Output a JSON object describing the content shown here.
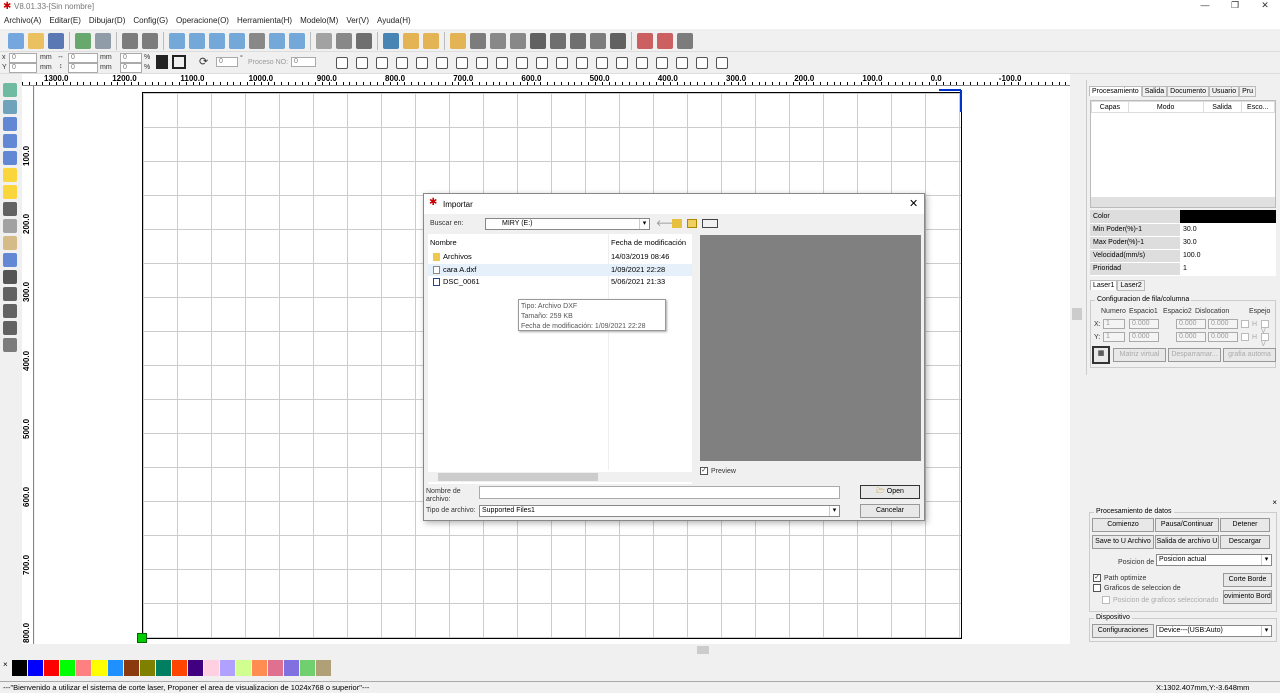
{
  "app": {
    "title": "V8.01.33-[Sin nombre]"
  },
  "window_controls": [
    "—",
    "❐",
    "✕"
  ],
  "menu": [
    "Archivo(A)",
    "Editar(E)",
    "Dibujar(D)",
    "Config(G)",
    "Operacione(O)",
    "Herramienta(H)",
    "Modelo(M)",
    "Ver(V)",
    "Ayuda(H)"
  ],
  "toolbar1_icons": [
    "new-file",
    "open-folder",
    "save",
    "import",
    "export",
    "back",
    "forward",
    "zoom-out-page",
    "zoom-in",
    "zoom-out",
    "zoom-fit",
    "zoom-actual",
    "zoom-select",
    "zoom-search",
    "rectangle-select",
    "node-edit",
    "smooth",
    "monitor",
    "layer-a",
    "layer-b",
    "layer-c",
    "curve",
    "bmp",
    "frame",
    "tree",
    "align-h",
    "measure",
    "camera",
    "book",
    "laser-pen",
    "red-dot-laser",
    "array"
  ],
  "toolbar2": {
    "x_label": "x",
    "y_label": "Y",
    "x_value": "0",
    "y_value": "0",
    "unit": "mm",
    "w_value": "0",
    "h_value": "0",
    "pct": "%",
    "sx_value": "0",
    "sy_value": "0",
    "rotate_value": "0",
    "degree": "°",
    "process_label": "Proceso NO:",
    "process_value": "0"
  },
  "ruler_top": [
    "1300.0",
    "1200.0",
    "1100.0",
    "1000.0",
    "900.0",
    "800.0",
    "700.0",
    "600.0",
    "500.0",
    "400.0",
    "300.0",
    "200.0",
    "100.0",
    "0.0",
    "-100.0"
  ],
  "ruler_left": [
    "100.0",
    "200.0",
    "300.0",
    "400.0",
    "500.0",
    "600.0",
    "700.0",
    "800.0"
  ],
  "right_panel": {
    "tabs": [
      "Procesamiento",
      "Salida",
      "Documento",
      "Usuario",
      "Pru"
    ],
    "layer_columns": [
      "Capas",
      "Modo",
      "Salida",
      "Esco..."
    ],
    "props": [
      {
        "label": "Color",
        "value": ""
      },
      {
        "label": "Min Poder(%)-1",
        "value": "30.0"
      },
      {
        "label": "Max Poder(%)-1",
        "value": "30.0"
      },
      {
        "label": "Velocidad(mm/s)",
        "value": "100.0"
      },
      {
        "label": "Prioridad",
        "value": "1"
      }
    ],
    "color_value": "#000000",
    "laser_tabs": [
      "Laser1",
      "Laser2"
    ],
    "array": {
      "title": "Configuracion de fila/columna",
      "cols": [
        "Numero",
        "Espacio1",
        "Espacio2",
        "Dislocation",
        "Espejo"
      ],
      "x_label": "X:",
      "y_label": "Y:",
      "x": [
        "1",
        "0.000",
        "0.000",
        "0.000"
      ],
      "y": [
        "1",
        "0.000",
        "0.000",
        "0.000"
      ],
      "h": "H",
      "v": "V",
      "buttons": [
        "Matriz virtual",
        "Desparramar...",
        "grafia automa"
      ]
    }
  },
  "data_panel": {
    "title": "Procesamiento de datos",
    "buttons": [
      "Comienzo",
      "Pausa/Continuar",
      "Detener",
      "Save to U Archivo",
      "Salida de archivo U",
      "Descargar"
    ],
    "pos_label": "Posicion de",
    "pos_value": "Posicion actual",
    "path_optimize": "Path optimize",
    "graficos_sel": "Graficos de seleccion de",
    "posicion_sel": "Posicion de graficos seleccionado",
    "corte_borde": "Corte Borde",
    "movimiento_borde": "ovimiento Bord",
    "device_title": "Dispositivo",
    "config_button": "Configuraciones",
    "device_value": "Device---(USB:Auto)"
  },
  "palette": [
    "#000000",
    "#0000ff",
    "#ff0000",
    "#00ff00",
    "#ff8080",
    "#ffff00",
    "#1e90ff",
    "#8b3a0f",
    "#808000",
    "#008060",
    "#ff4500",
    "#400080",
    "#ffd0e0",
    "#b0a0ff",
    "#d0ff90",
    "#ff8c50",
    "#e07090",
    "#8070e0",
    "#70d070",
    "#b0a078"
  ],
  "status": {
    "message": "---\"Bienvenido a utilizar el sistema de corte laser, Proponer el area de visualizacion de 1024x768 o superior\"---",
    "coords": "X:1302.407mm,Y:-3.648mm"
  },
  "dialog": {
    "title": "Importar",
    "look_in_label": "Buscar en:",
    "look_in_value": "MIRY (E:)",
    "col_name": "Nombre",
    "col_date": "Fecha de modificación",
    "files": [
      {
        "name": "Archivos",
        "date": "14/03/2019 08:46",
        "icon": "folder"
      },
      {
        "name": "cara A.dxf",
        "date": "1/09/2021 22:28",
        "icon": "file"
      },
      {
        "name": "DSC_0061",
        "date": "5/06/2021 21:33",
        "icon": "image"
      }
    ],
    "tooltip": [
      "Tipo: Archivo DXF",
      "Tamaño: 259 KB",
      "Fecha de modificación: 1/09/2021 22:28"
    ],
    "preview_label": "Preview",
    "filename_label": "Nombre de archivo:",
    "filename_value": "",
    "filetype_label": "Tipo de archivo:",
    "filetype_value": "Supported Files1",
    "open": "Open",
    "cancel": "Cancelar"
  }
}
